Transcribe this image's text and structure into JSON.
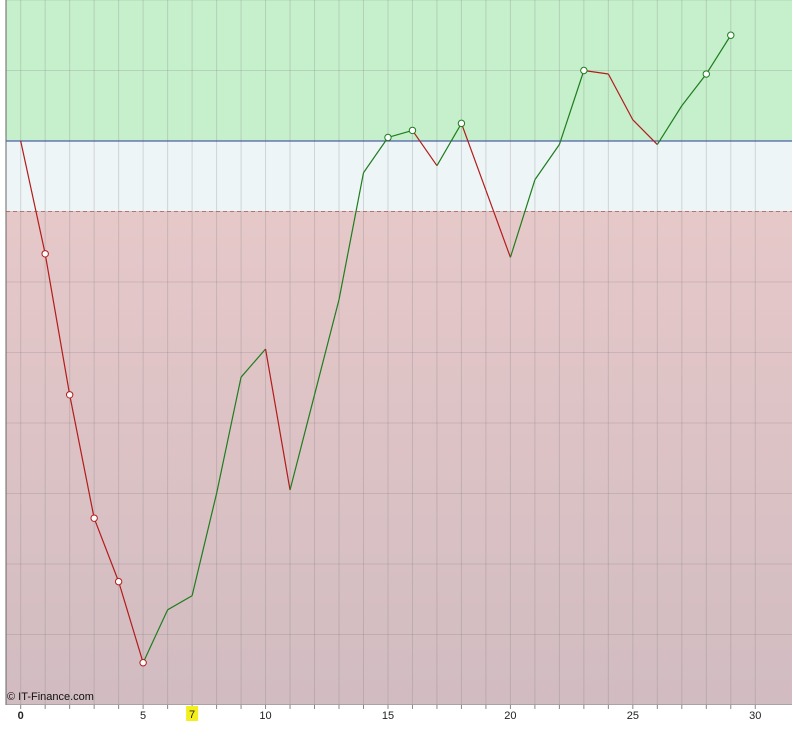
{
  "watermark": "© IT-Finance.com",
  "highlighted_tick": "7",
  "colors": {
    "upper_zone": "#c6efcc",
    "middle_zone": "#edf5f7",
    "lower_zone_top": "#e6c8c9",
    "lower_zone_bottom": "#d1bcc1",
    "rising_segment": "#1e7d1e",
    "falling_segment": "#b31b1b",
    "reference_line": "#2d3a9c",
    "highlight": "#f4ee1c"
  },
  "chart_data": {
    "type": "line",
    "title": "",
    "xlabel": "",
    "ylabel": "",
    "xlim": [
      -0.6,
      31.5
    ],
    "ylim": [
      0,
      100
    ],
    "x_ticks": [
      "0",
      "5",
      "10",
      "15",
      "20",
      "25",
      "30"
    ],
    "grid": true,
    "zones": [
      {
        "name": "upper",
        "from": 80,
        "to": 100
      },
      {
        "name": "middle",
        "from": 70,
        "to": 80
      },
      {
        "name": "lower",
        "from": 0,
        "to": 70
      }
    ],
    "reference_line": 80,
    "x": [
      0,
      1,
      2,
      3,
      4,
      5,
      6,
      7,
      8,
      9,
      10,
      11,
      12,
      13,
      14,
      15,
      16,
      17,
      18,
      19,
      20,
      21,
      22,
      23,
      24,
      25,
      26,
      27,
      28,
      29
    ],
    "values": [
      80,
      64,
      44,
      26.5,
      17.5,
      6,
      13.5,
      15.5,
      30,
      46.5,
      50.5,
      30.5,
      44,
      57.5,
      75.5,
      80.5,
      81.5,
      76.5,
      82.5,
      73,
      63.5,
      74.5,
      79.5,
      90,
      89.5,
      83,
      79.5,
      85,
      89.5,
      95
    ],
    "markers": [
      1,
      2,
      3,
      4,
      5,
      15,
      16,
      18,
      23,
      28,
      29
    ]
  }
}
